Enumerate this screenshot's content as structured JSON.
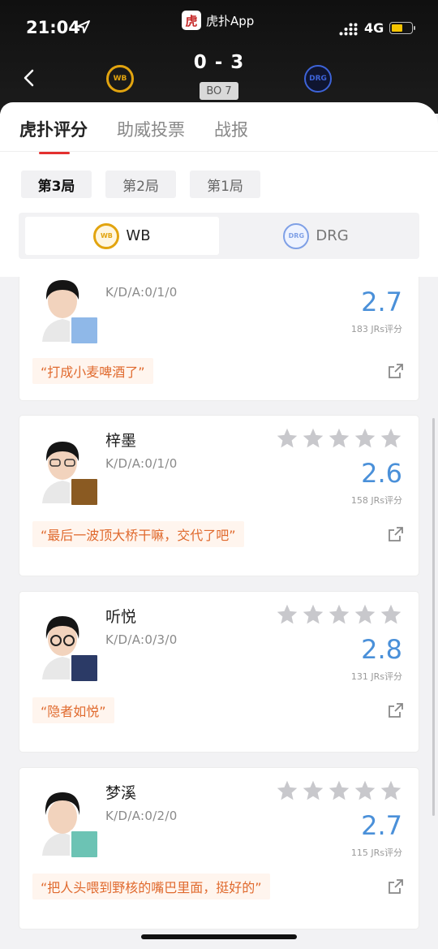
{
  "status": {
    "time": "21:04",
    "network": "4G"
  },
  "app": {
    "name": "虎扑App",
    "logo_glyph": "虎"
  },
  "match": {
    "score": "0 - 3",
    "format": "BO 7",
    "team_home": "WB",
    "team_away": "DRG"
  },
  "tabs": [
    {
      "label": "虎扑评分",
      "active": true
    },
    {
      "label": "助威投票",
      "active": false
    },
    {
      "label": "战报",
      "active": false
    }
  ],
  "games": [
    {
      "label": "第3局",
      "active": true
    },
    {
      "label": "第2局",
      "active": false
    },
    {
      "label": "第1局",
      "active": false
    }
  ],
  "team_toggle": [
    {
      "label": "WB",
      "logo": "WB",
      "active": true
    },
    {
      "label": "DRG",
      "logo": "DRG",
      "active": false
    }
  ],
  "players": [
    {
      "name": "",
      "kda": "K/D/A:0/1/0",
      "rating": "2.7",
      "votes": "183 JRs评分",
      "quote": "“打成小麦啤酒了”",
      "hero_color": "#8fb8e8"
    },
    {
      "name": "梓墨",
      "kda": "K/D/A:0/1/0",
      "rating": "2.6",
      "votes": "158 JRs评分",
      "quote": "“最后一波顶大桥干嘛，交代了吧”",
      "hero_color": "#8a5a22"
    },
    {
      "name": "听悦",
      "kda": "K/D/A:0/3/0",
      "rating": "2.8",
      "votes": "131 JRs评分",
      "quote": "“隐者如悦”",
      "hero_color": "#2b3a66"
    },
    {
      "name": "梦溪",
      "kda": "K/D/A:0/2/0",
      "rating": "2.7",
      "votes": "115 JRs评分",
      "quote": "“把人头喂到野核的嘴巴里面，挺好的”",
      "hero_color": "#6cc3b4"
    }
  ],
  "colors": {
    "accent_red": "#e3302f",
    "rating_blue": "#4a90d9",
    "quote_orange": "#e06a2e",
    "star_gray": "#c8c8cc"
  },
  "icons": [
    "location-arrow-icon",
    "signal-icon",
    "battery-icon",
    "back-chevron-icon",
    "star-icon",
    "share-icon"
  ]
}
